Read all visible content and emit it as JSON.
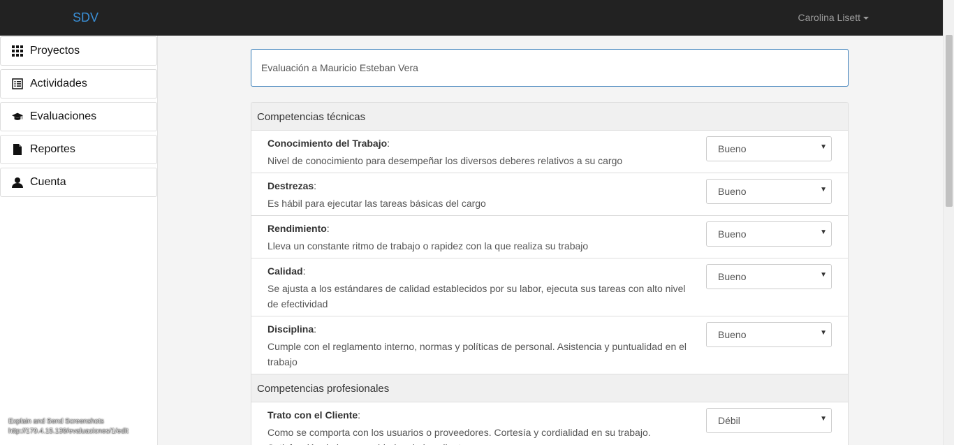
{
  "navbar": {
    "brand": "SDV",
    "user": "Carolina Lisett"
  },
  "sidebar": {
    "items": [
      {
        "label": "Proyectos",
        "icon": "grid-icon"
      },
      {
        "label": "Actividades",
        "icon": "list-icon"
      },
      {
        "label": "Evaluaciones",
        "icon": "graduation-cap-icon"
      },
      {
        "label": "Reportes",
        "icon": "file-icon"
      },
      {
        "label": "Cuenta",
        "icon": "user-icon"
      }
    ]
  },
  "footer_note": {
    "line1": "Explain and Send Screenshots",
    "line2": "http://179.4.15.139/evaluaciones/1/edit"
  },
  "evaluation": {
    "title": "Evaluación a Mauricio Esteban Vera"
  },
  "sections": [
    {
      "title": "Competencias técnicas",
      "rows": [
        {
          "name": "Conocimiento del Trabajo",
          "desc": "Nivel de conocimiento para desempeñar los diversos deberes relativos a su cargo",
          "value": "Bueno"
        },
        {
          "name": "Destrezas",
          "desc": "Es hábil para ejecutar las tareas básicas del cargo",
          "value": "Bueno"
        },
        {
          "name": "Rendimiento",
          "desc": "Lleva un constante ritmo de trabajo o rapidez con la que realiza su trabajo",
          "value": "Bueno"
        },
        {
          "name": "Calidad",
          "desc": "Se ajusta a los estándares de calidad establecidos por su labor, ejecuta sus tareas con alto nivel de efectividad",
          "value": "Bueno"
        },
        {
          "name": "Disciplina",
          "desc": "Cumple con el reglamento interno, normas y políticas de personal. Asistencia y puntualidad en el trabajo",
          "value": "Bueno"
        }
      ]
    },
    {
      "title": "Competencias profesionales",
      "rows": [
        {
          "name": "Trato con el Cliente",
          "desc": "Como se comporta con los usuarios o proveedores. Cortesía y cordialidad en su trabajo. Satisfacción de las necesidades de los clientes",
          "value": "Débil"
        }
      ]
    }
  ]
}
